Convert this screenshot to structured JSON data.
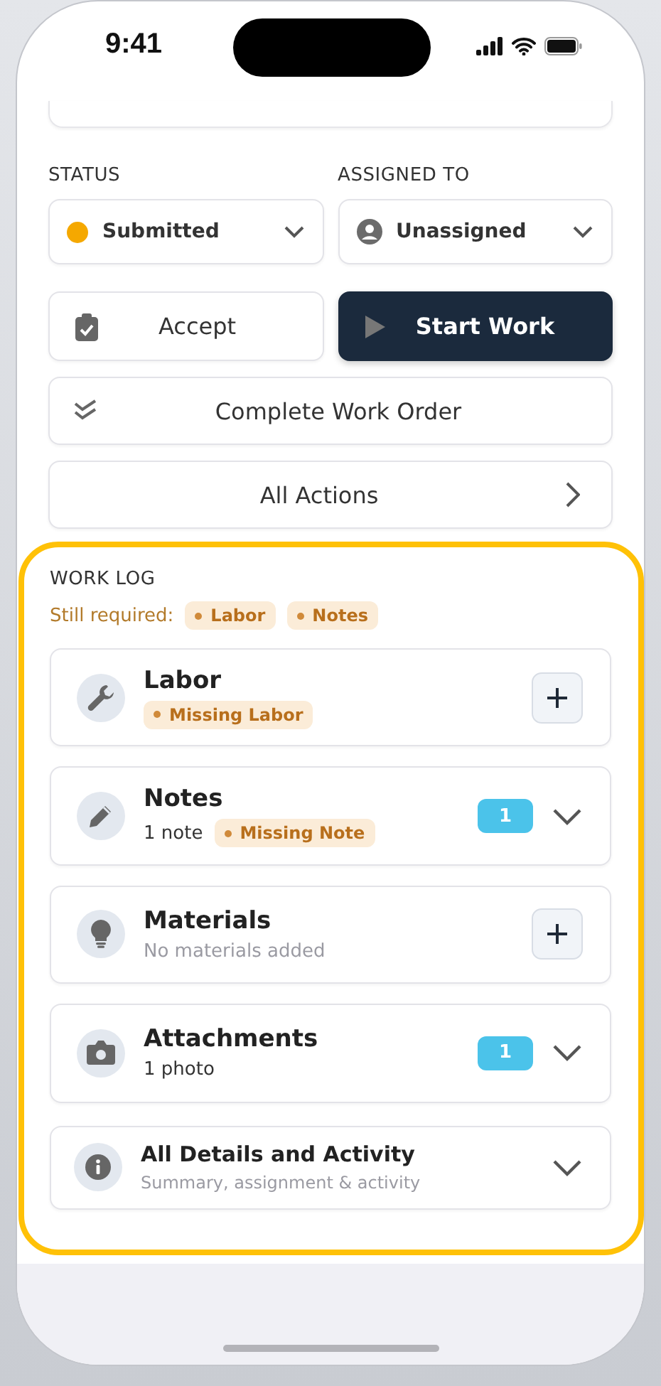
{
  "status_bar": {
    "time": "9:41"
  },
  "status": {
    "label": "STATUS",
    "value": "Submitted",
    "color": "#f5a800"
  },
  "assigned": {
    "label": "ASSIGNED TO",
    "value": "Unassigned"
  },
  "actions": [
    {
      "label": "Accept",
      "primary": false
    },
    {
      "label": "Start Work",
      "primary": true
    }
  ],
  "complete_button": "Complete Work Order",
  "all_actions": "All Actions",
  "work_log": {
    "title": "WORK LOG",
    "required_label": "Still required:",
    "required": [
      "Labor",
      "Notes"
    ],
    "items": [
      {
        "title": "Labor",
        "kind": "add",
        "tag": "Missing Labor"
      },
      {
        "title": "Notes",
        "kind": "expand",
        "subtitle": "1 note",
        "muted": false,
        "tag": "Missing Note",
        "count": "1"
      },
      {
        "title": "Materials",
        "kind": "add",
        "subtitle": "No materials added",
        "muted": true
      },
      {
        "title": "Attachments",
        "kind": "expand",
        "subtitle": "1 photo",
        "muted": false,
        "count": "1"
      }
    ],
    "details": {
      "title": "All Details and Activity",
      "subtitle": "Summary, assignment & activity"
    }
  }
}
